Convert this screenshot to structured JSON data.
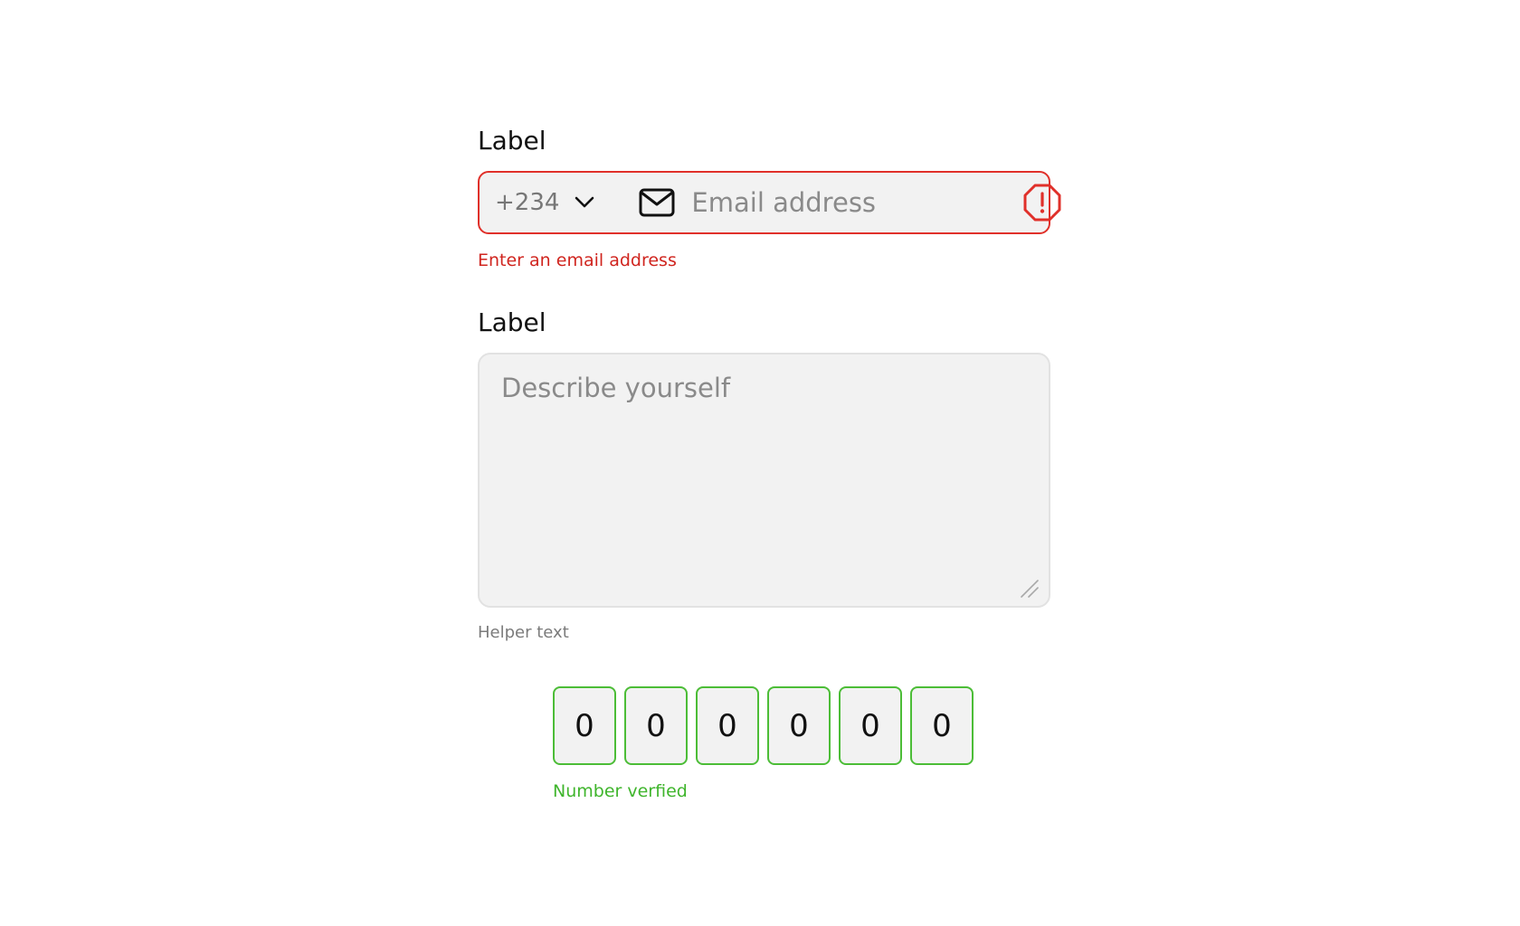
{
  "email_field": {
    "label": "Label",
    "country_code": "+234",
    "placeholder": "Email address",
    "error": "Enter an email address",
    "icons": {
      "dropdown": "chevron-down-icon",
      "mail": "mail-icon",
      "error": "alert-octagon-icon"
    }
  },
  "description_field": {
    "label": "Label",
    "placeholder": "Describe yourself",
    "helper": "Helper text"
  },
  "otp": {
    "digits": [
      "0",
      "0",
      "0",
      "0",
      "0",
      "0"
    ],
    "status": "Number verfied"
  },
  "colors": {
    "error": "#e0302a",
    "success": "#4cbd37",
    "field_bg": "#f2f2f2",
    "placeholder": "#8a8a8a"
  }
}
